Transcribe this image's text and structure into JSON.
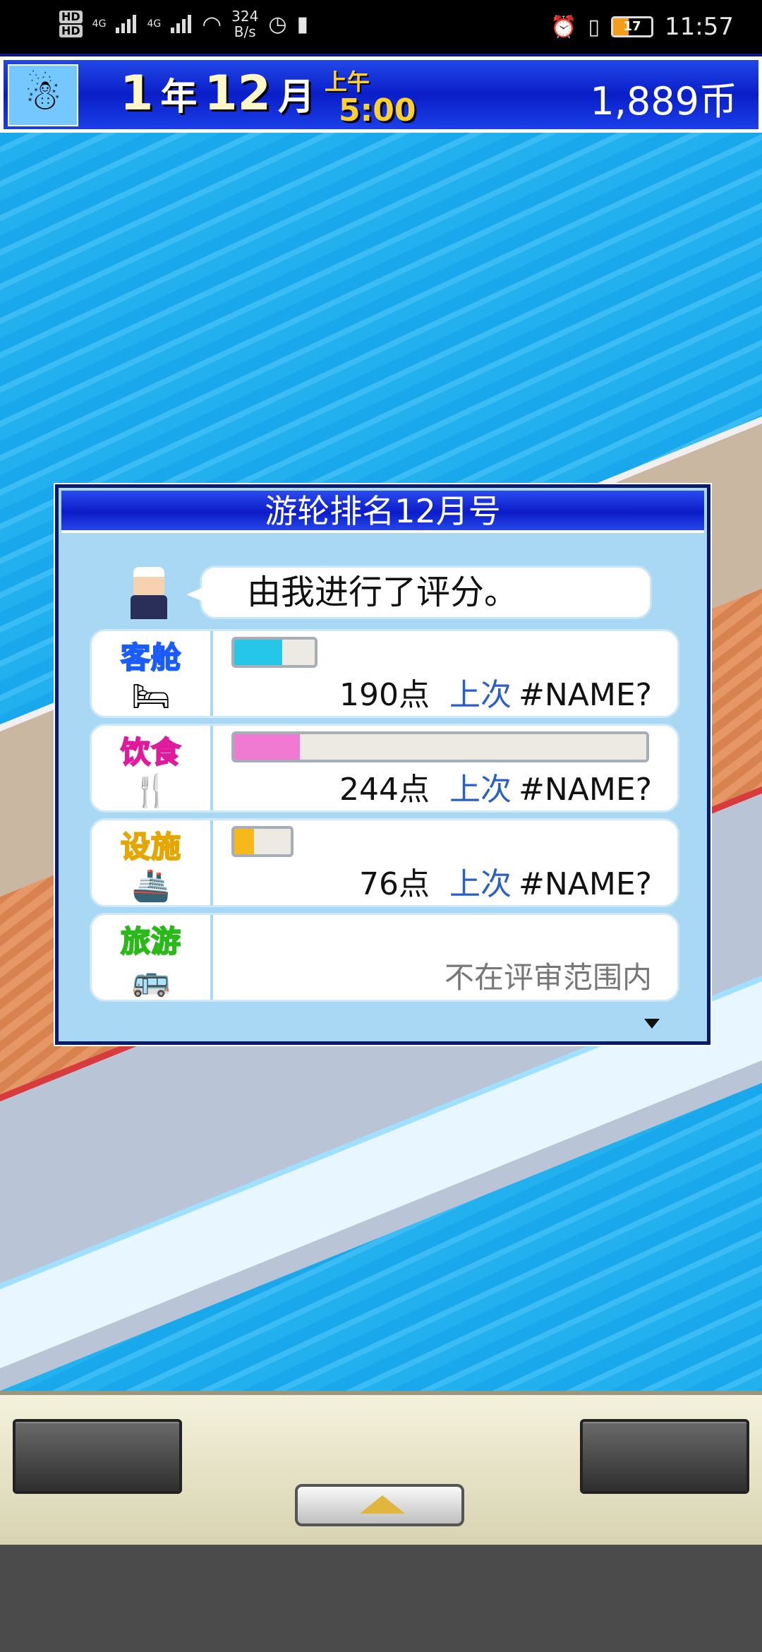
{
  "status_bar": {
    "hd1": "HD",
    "hd2": "HD",
    "net1": "4G",
    "net2": "4G",
    "speed_value": "324",
    "speed_unit": "B/s",
    "battery": "17",
    "time": "11:57"
  },
  "hud": {
    "year_num": "1",
    "year_unit": "年",
    "month_num": "12",
    "month_unit": "月",
    "ampm": "上午",
    "clock": "5:00",
    "money": "1,889币"
  },
  "dialog": {
    "title": "游轮排名12月号",
    "speech": "由我进行了评分。",
    "rows": [
      {
        "category": "客舱",
        "color": "#1a5cff",
        "icon": "bed-icon",
        "fill_percent": 14,
        "bar_color": "#26c6e8",
        "points": "190点",
        "last_label": "上次",
        "last_value": "#NAME?"
      },
      {
        "category": "饮食",
        "color": "#e01a9c",
        "icon": "food-icon",
        "fill_percent": 17,
        "bar_color": "#f07ad2",
        "points": "244点",
        "last_label": "上次",
        "last_value": "#NAME?"
      },
      {
        "category": "设施",
        "color": "#e6a600",
        "icon": "boat-icon",
        "fill_percent": 6,
        "bar_color": "#f6b81a",
        "points": "76点",
        "last_label": "上次",
        "last_value": "#NAME?"
      },
      {
        "category": "旅游",
        "color": "#2bb81a",
        "icon": "bus-icon",
        "not_rated": "不在评审范围内"
      }
    ]
  }
}
